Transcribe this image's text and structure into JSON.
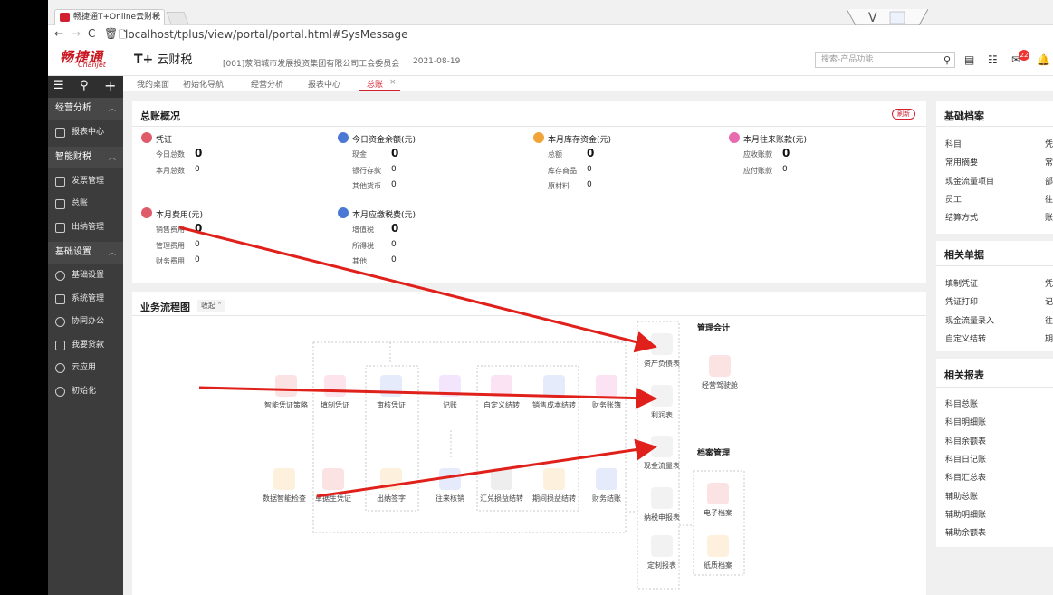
{
  "browser": {
    "tab_title": "畅捷通T+Online云财税",
    "url": "localhost/tplus/view/portal/portal.html#SysMessage"
  },
  "header": {
    "logo_cn": "畅捷通",
    "logo_en": "Chanjet",
    "product_prefix": "T+",
    "product_name": "云财税",
    "company": "[001]荥阳城市发展投资集团有限公司工会委员会",
    "date": "2021-08-19",
    "search_placeholder": "搜索-产品功能",
    "badge_count": "22"
  },
  "sidebar": {
    "groups": [
      {
        "label": "经营分析",
        "items": [
          "报表中心"
        ]
      },
      {
        "label": "智能财税",
        "items": [
          "发票管理",
          "总账",
          "出纳管理"
        ]
      },
      {
        "label": "基础设置",
        "items": [
          "基础设置",
          "系统管理",
          "协同办公",
          "我要贷款",
          "云应用",
          "初始化"
        ]
      }
    ]
  },
  "page_tabs": [
    "我的桌面",
    "初始化导航",
    "经营分析",
    "报表中心",
    "总账"
  ],
  "overview": {
    "title": "总账概况",
    "refresh": "刷新",
    "groups": [
      {
        "title": "凭证",
        "color": "#e05b6a",
        "rows": [
          [
            "今日总数",
            "0"
          ],
          [
            "本月总数",
            "0"
          ]
        ]
      },
      {
        "title": "今日资金余额(元)",
        "color": "#4a78d4",
        "rows": [
          [
            "现金",
            "0"
          ],
          [
            "银行存款",
            "0"
          ],
          [
            "其他货币",
            "0"
          ]
        ]
      },
      {
        "title": "本月库存资金(元)",
        "color": "#f0a43a",
        "rows": [
          [
            "总额",
            "0"
          ],
          [
            "库存商品",
            "0"
          ],
          [
            "原材料",
            "0"
          ]
        ]
      },
      {
        "title": "本月往来账款(元)",
        "color": "#e86bb0",
        "rows": [
          [
            "应收账款",
            "0"
          ],
          [
            "应付账款",
            "0"
          ]
        ]
      },
      {
        "title": "本月费用(元)",
        "color": "#e05b6a",
        "rows": [
          [
            "销售费用",
            "0"
          ],
          [
            "管理费用",
            "0"
          ],
          [
            "财务费用",
            "0"
          ]
        ]
      },
      {
        "title": "本月应缴税费(元)",
        "color": "#4a78d4",
        "rows": [
          [
            "增值税",
            "0"
          ],
          [
            "所得税",
            "0"
          ],
          [
            "其他",
            "0"
          ]
        ]
      }
    ]
  },
  "flow": {
    "title": "业务流程图",
    "collapse": "收起",
    "mgmt_title": "管理会计",
    "archive_title": "档案管理",
    "nodes": {
      "n1": "智能凭证策略",
      "n2": "填制凭证",
      "n3": "审核凭证",
      "n4": "记账",
      "n5": "自定义结转",
      "n6": "销售成本结转",
      "n7": "财务账簿",
      "n8": "数据智能检查",
      "n9": "单据生凭证",
      "n10": "出纳签字",
      "n11": "往来核销",
      "n12": "汇兑损益结转",
      "n13": "期间损益结转",
      "n14": "财务结账",
      "r1": "资产负债表",
      "r2": "利润表",
      "r3": "现金流量表",
      "r4": "纳税申报表",
      "r5": "定制报表",
      "m1": "经营驾驶舱",
      "a1": "电子档案",
      "a2": "纸质档案"
    }
  },
  "right": {
    "basic_title": "基础档案",
    "basic_col1": [
      "科目",
      "常用摘要",
      "现金流量项目",
      "员工",
      "结算方式"
    ],
    "basic_col2": [
      "凭",
      "常",
      "部",
      "往",
      "账"
    ],
    "docs_title": "相关单据",
    "docs_col1": [
      "填制凭证",
      "凭证打印",
      "现金流量录入",
      "自定义结转"
    ],
    "docs_col2": [
      "凭",
      "记",
      "往",
      "期"
    ],
    "reports_title": "相关报表",
    "reports": [
      "科目总账",
      "科目明细账",
      "科目余额表",
      "科目日记账",
      "科目汇总表",
      "辅助总账",
      "辅助明细账",
      "辅助余额表"
    ]
  }
}
